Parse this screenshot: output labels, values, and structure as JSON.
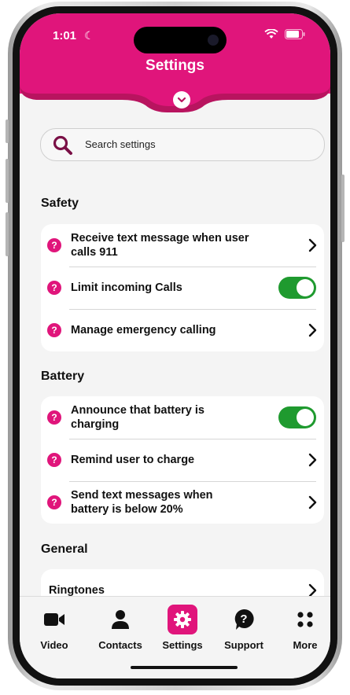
{
  "status": {
    "time": "1:01"
  },
  "header": {
    "title": "Settings"
  },
  "search": {
    "placeholder": "Search settings"
  },
  "sections": {
    "safety": {
      "title": "Safety",
      "rows": [
        {
          "label": "Receive text message when user calls 911",
          "control": "chevron"
        },
        {
          "label": "Limit incoming Calls",
          "control": "toggle",
          "on": true
        },
        {
          "label": "Manage emergency calling",
          "control": "chevron"
        }
      ]
    },
    "battery": {
      "title": "Battery",
      "rows": [
        {
          "label": "Announce that battery is charging",
          "control": "toggle",
          "on": true
        },
        {
          "label": "Remind user to charge",
          "control": "chevron"
        },
        {
          "label": "Send text messages when battery is below 20%",
          "control": "chevron"
        }
      ]
    },
    "general": {
      "title": "General",
      "rows": [
        {
          "label": "Ringtones",
          "control": "chevron"
        }
      ]
    }
  },
  "tabs": [
    {
      "label": "Video",
      "icon": "video-icon"
    },
    {
      "label": "Contacts",
      "icon": "person-icon"
    },
    {
      "label": "Settings",
      "icon": "gear-icon",
      "active": true
    },
    {
      "label": "Support",
      "icon": "question-bubble-icon"
    },
    {
      "label": "More",
      "icon": "grid-dots-icon"
    }
  ],
  "colors": {
    "accent": "#e0157b",
    "toggle_on": "#1f9a2f",
    "background": "#f4f4f4"
  }
}
